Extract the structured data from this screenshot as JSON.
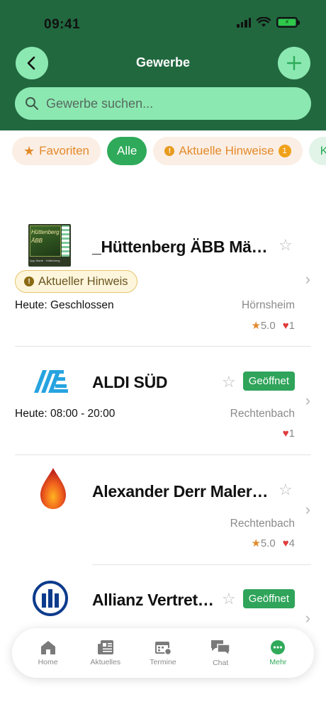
{
  "status_bar": {
    "time": "09:41"
  },
  "header": {
    "title": "Gewerbe",
    "search_placeholder": "Gewerbe suchen...",
    "colors": {
      "background": "#21683f",
      "button": "#8ce8b1"
    }
  },
  "chips": {
    "favorites": "Favoriten",
    "all": "Alle",
    "hints": "Aktuelle Hinweise",
    "hints_count": "1",
    "categories": "Kate"
  },
  "businesses": [
    {
      "name": "_Hüttenberg ÄBB Mächer /...",
      "hint_label": "Aktueller Hinweis",
      "hours": "Heute: Geschlossen",
      "location": "Hörnsheim",
      "rating": "5.0",
      "likes": "1",
      "logo_lines": [
        "Hüttenberg",
        "ÄBB",
        "App-Starte · Hüttenberg"
      ]
    },
    {
      "name": "ALDI SÜD",
      "status": "Geöffnet",
      "hours": "Heute: 08:00 - 20:00",
      "location": "Rechtenbach",
      "likes": "1"
    },
    {
      "name": "Alexander Derr Malerbetrie...",
      "location": "Rechtenbach",
      "rating": "5.0",
      "likes": "4"
    },
    {
      "name": "Allianz Vertretung...",
      "status": "Geöffnet"
    }
  ],
  "tabbar": {
    "tabs": [
      {
        "label": "Home",
        "icon": "home-icon"
      },
      {
        "label": "Aktuelles",
        "icon": "news-icon"
      },
      {
        "label": "Termine",
        "icon": "calendar-icon"
      },
      {
        "label": "Chat",
        "icon": "chat-icon"
      },
      {
        "label": "Mehr",
        "icon": "more-icon",
        "active": true
      }
    ],
    "active_color": "#2faa5a"
  }
}
